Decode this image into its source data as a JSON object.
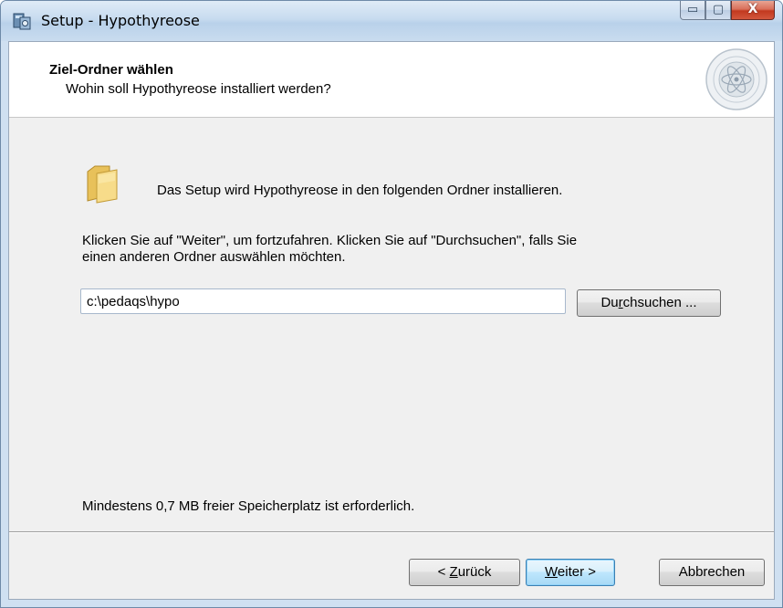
{
  "window": {
    "title": "Setup - Hypothyreose",
    "buttons": {
      "minimize": "▭",
      "maximize": "▢",
      "close": "X"
    }
  },
  "header": {
    "title": "Ziel-Ordner wählen",
    "subtitle": "Wohin soll Hypothyreose installiert werden?",
    "logo_icon": "university-seal-icon"
  },
  "body": {
    "folder_icon": "folder-icon",
    "intro": "Das Setup wird Hypothyreose in den folgenden Ordner installieren.",
    "instructions_line1": "Klicken Sie auf \"Weiter\", um fortzufahren. Klicken Sie auf \"Durchsuchen\", falls Sie",
    "instructions_line2": "einen anderen Ordner auswählen möchten.",
    "path_value": "c:\\pedaqs\\hypo",
    "browse_button": {
      "before": "Du",
      "accel": "r",
      "after": "chsuchen ..."
    },
    "disk_space": "Mindestens 0,7 MB freier Speicherplatz ist erforderlich."
  },
  "footer": {
    "back_button": {
      "before": "< ",
      "accel": "Z",
      "after": "urück"
    },
    "next_button": {
      "before": "",
      "accel": "W",
      "after": "eiter >"
    },
    "cancel_button": "Abbrechen"
  },
  "colors": {
    "titlebar": "#c7dbef",
    "close_button": "#c2391f",
    "default_button_border": "#3c7fb1",
    "dialog_background": "#f0f0f0"
  }
}
